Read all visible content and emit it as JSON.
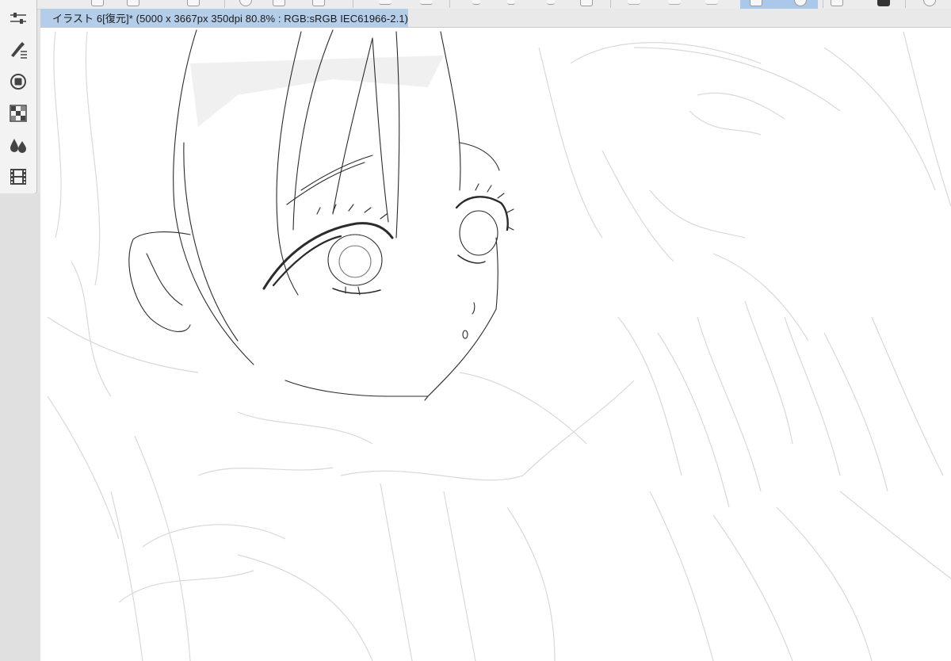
{
  "document_tab": {
    "title": "イラスト 6[復元]* (5000 x 3667px 350dpi 80.8% : RGB:sRGB IEC61966-2.1)"
  },
  "palette": {
    "tools": [
      {
        "icon": "sliders-icon"
      },
      {
        "icon": "pen-settings-icon"
      },
      {
        "icon": "circle-layer-icon"
      },
      {
        "icon": "color-grid-icon"
      },
      {
        "icon": "ink-drops-icon"
      },
      {
        "icon": "film-icon"
      }
    ]
  },
  "colors": {
    "tab_active": "#b4cde8",
    "toolbar_active": "#a9c8ea",
    "canvas": "#ffffff"
  }
}
